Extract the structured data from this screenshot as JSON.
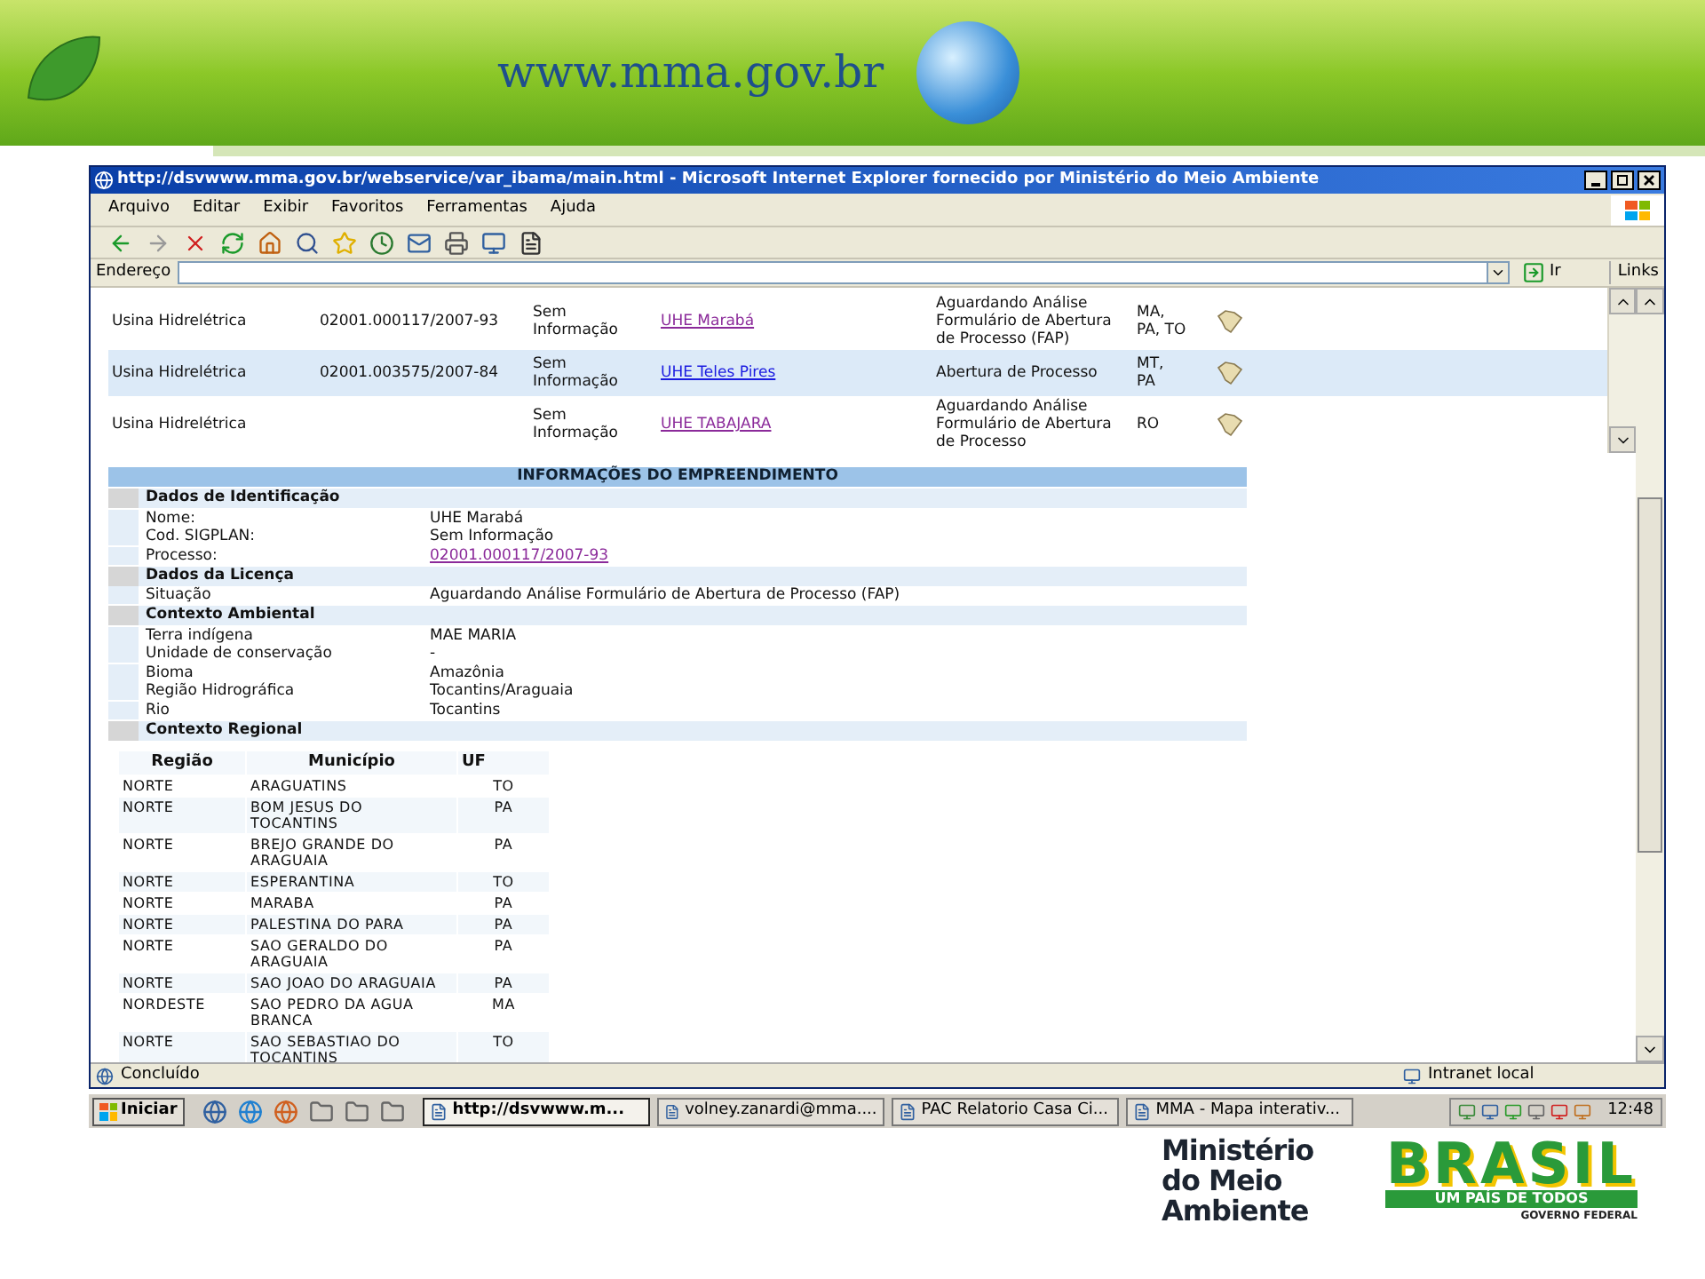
{
  "banner": {
    "site": "www.mma.gov.br"
  },
  "browser": {
    "title": "http://dsvwww.mma.gov.br/webservice/var_ibama/main.html - Microsoft Internet Explorer fornecido por Ministério do Meio Ambiente",
    "menu": [
      "Arquivo",
      "Editar",
      "Exibir",
      "Favoritos",
      "Ferramentas",
      "Ajuda"
    ],
    "address_label": "Endereço",
    "go": "Ir",
    "links": "Links"
  },
  "results": [
    {
      "type": "Usina Hidrelétrica",
      "processo": "02001.000117/2007-93",
      "sigplan": "Sem Informação",
      "name": "UHE Marabá",
      "visited": true,
      "situacao": "Aguardando Análise Formulário de Abertura de Processo (FAP)",
      "uf": "MA, PA, TO",
      "selected": false
    },
    {
      "type": "Usina Hidrelétrica",
      "processo": "02001.003575/2007-84",
      "sigplan": "Sem Informação",
      "name": "UHE Teles Pires",
      "visited": false,
      "situacao": "Abertura de Processo",
      "uf": "MT, PA",
      "selected": true
    },
    {
      "type": "Usina Hidrelétrica",
      "sigplan": "Sem Informação",
      "name": "UHE TABAJARA",
      "visited": true,
      "situacao": "Aguardando Análise Formulário de Abertura de Processo",
      "uf": "RO",
      "selected": false
    }
  ],
  "details": {
    "title": "INFORMAÇÕES DO EMPREENDIMENTO",
    "groups": [
      {
        "heading": "Dados de Identificação",
        "fields": [
          {
            "label": "Nome:",
            "value": "UHE Marabá",
            "kind": "text"
          },
          {
            "label": "Cod. SIGPLAN:",
            "value": "Sem Informação",
            "kind": "text"
          },
          {
            "label": "Processo:",
            "value": "02001.000117/2007-93",
            "kind": "link"
          }
        ]
      },
      {
        "heading": "Dados da Licença",
        "fields": [
          {
            "label": "Situação",
            "value": "Aguardando Análise Formulário de Abertura de Processo (FAP)",
            "kind": "text"
          }
        ]
      },
      {
        "heading": "Contexto Ambiental",
        "fields": [
          {
            "label": "Terra indígena",
            "value": "MAE MARIA",
            "kind": "text"
          },
          {
            "label": "Unidade de conservação",
            "value": "-",
            "kind": "text"
          },
          {
            "label": "Bioma",
            "value": "Amazônia",
            "kind": "text"
          },
          {
            "label": "Região Hidrográfica",
            "value": "Tocantins/Araguaia",
            "kind": "text"
          },
          {
            "label": "Rio",
            "value": "Tocantins",
            "kind": "text"
          }
        ]
      },
      {
        "heading": "Contexto Regional"
      }
    ]
  },
  "regional": {
    "columns": [
      "Região",
      "Município",
      "UF"
    ],
    "rows": [
      [
        "NORTE",
        "ARAGUATINS",
        "TO"
      ],
      [
        "NORTE",
        "BOM JESUS DO TOCANTINS",
        "PA"
      ],
      [
        "NORTE",
        "BREJO GRANDE DO ARAGUAIA",
        "PA"
      ],
      [
        "NORTE",
        "ESPERANTINA",
        "TO"
      ],
      [
        "NORTE",
        "MARABA",
        "PA"
      ],
      [
        "NORTE",
        "PALESTINA DO PARA",
        "PA"
      ],
      [
        "NORTE",
        "SAO GERALDO DO ARAGUAIA",
        "PA"
      ],
      [
        "NORTE",
        "SAO JOAO DO ARAGUAIA",
        "PA"
      ],
      [
        "NORDESTE",
        "SAO PEDRO DA AGUA BRANCA",
        "MA"
      ],
      [
        "NORTE",
        "SAO SEBASTIAO DO TOCANTINS",
        "TO"
      ]
    ]
  },
  "status_bar": {
    "status": "Concluído",
    "zone": "Intranet local"
  },
  "taskbar": {
    "start": "Iniciar",
    "tasks": [
      {
        "label": "http://dsvwww.m...",
        "selected": true
      },
      {
        "label": "volney.zanardi@mma....",
        "selected": false
      },
      {
        "label": "PAC Relatorio Casa Ci...",
        "selected": false
      },
      {
        "label": "MMA - Mapa interativ...",
        "selected": false
      }
    ],
    "clock": "12:48"
  },
  "footer": {
    "ministry": "Ministério do Meio Ambiente",
    "brand": "BRASIL",
    "slogan": "UM PAÍS DE TODOS",
    "government": "GOVERNO FEDERAL"
  }
}
